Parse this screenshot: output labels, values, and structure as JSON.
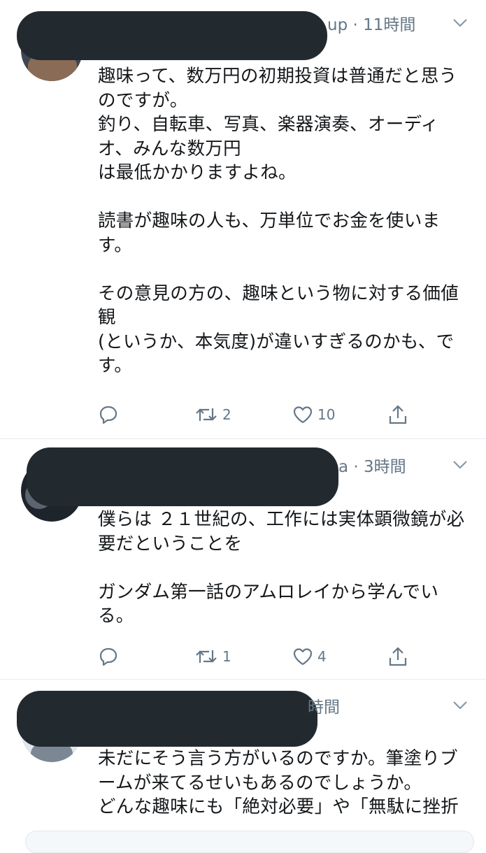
{
  "tweets": [
    {
      "handle_tail": "up",
      "time": "11時間",
      "text": "趣味って、数万円の初期投資は普通だと思うのですが。\n釣り、自転車、写真、楽器演奏、オーディオ、みんな数万円\nは最低かかりますよね。\n\n読書が趣味の人も、万単位でお金を使います。\n\nその意見の方の、趣味という物に対する価値観\n(というか、本気度)が違いすぎるのかも、です。",
      "reply_count": "",
      "retweet_count": "2",
      "like_count": "10"
    },
    {
      "handle_tail": "a",
      "time": "3時間",
      "text": "僕らは ２１世紀の、工作には実体顕微鏡が必要だということを\n\nガンダム第一話のアムロレイから学んでいる。",
      "reply_count": "",
      "retweet_count": "1",
      "like_count": "4"
    },
    {
      "handle_tail": "",
      "time": "時間",
      "text": "未だにそう言う方がいるのですか。筆塗りブームが来てるせいもあるのでしょうか。\nどんな趣味にも「絶対必要」や「無駄に挫折",
      "reply_count": "",
      "retweet_count": "",
      "like_count": ""
    }
  ],
  "icons": {
    "reply": "reply-icon",
    "retweet": "retweet-icon",
    "like": "heart-icon",
    "share": "share-icon",
    "more": "chevron-down-icon"
  },
  "colors": {
    "text": "#14171a",
    "secondary": "#657786",
    "divider": "#e6ecf0",
    "redaction": "#22292f"
  }
}
